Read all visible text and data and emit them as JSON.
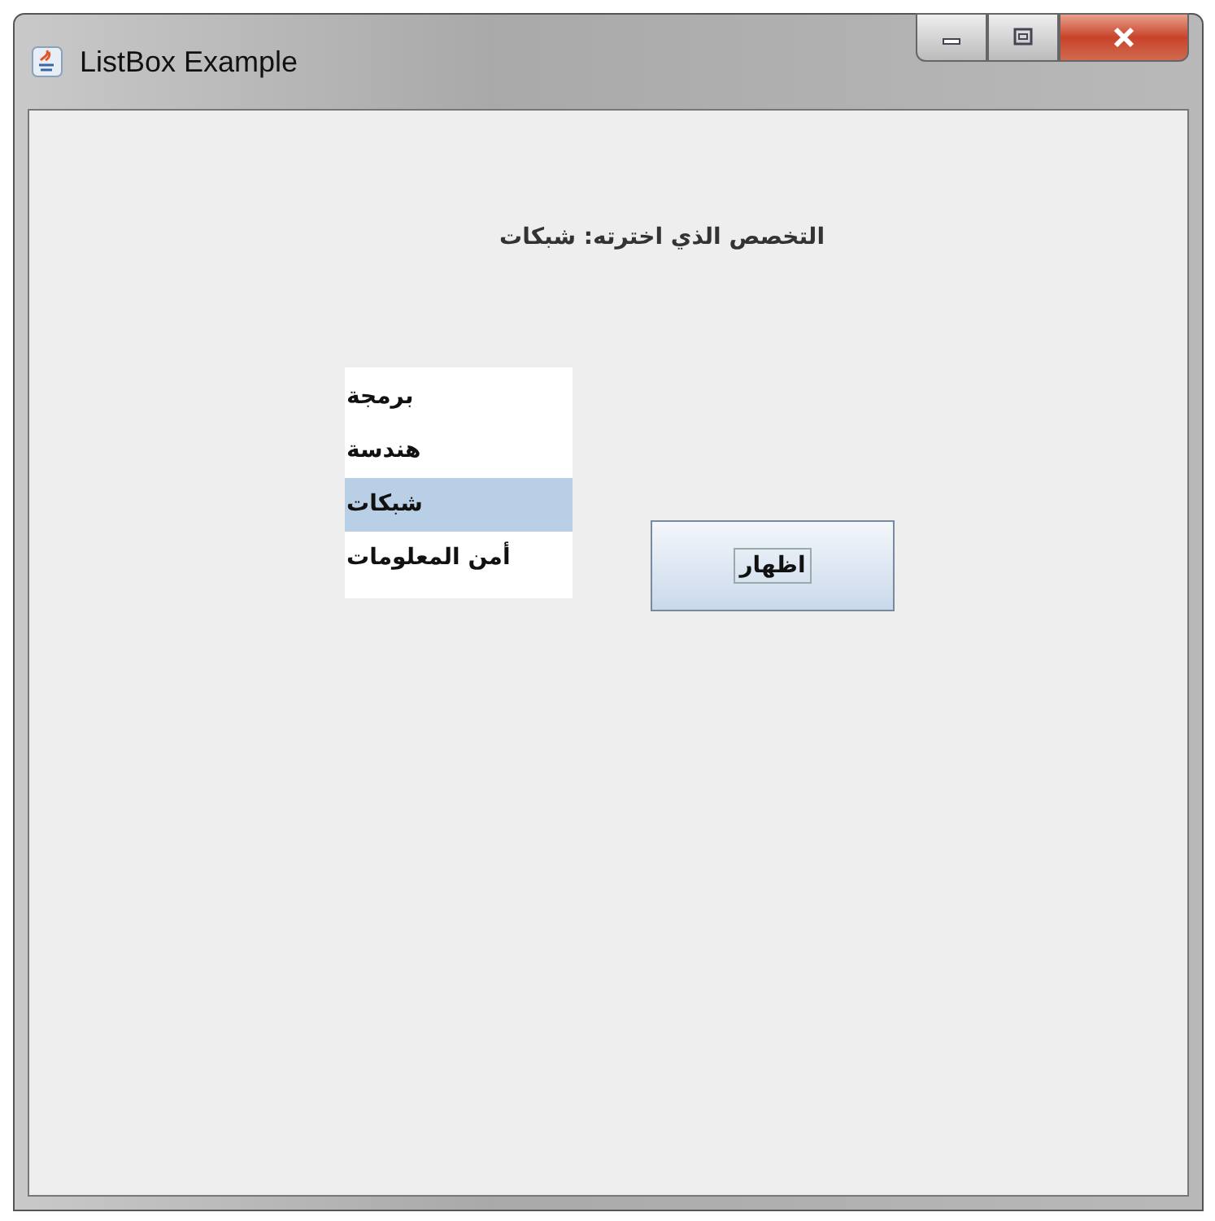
{
  "window": {
    "title": "ListBox Example"
  },
  "label": "التخصص الذي اخترته: شبكات",
  "list": [
    {
      "text": "برمجة",
      "selected": false
    },
    {
      "text": "هندسة",
      "selected": false
    },
    {
      "text": "شبكات",
      "selected": true
    },
    {
      "text": "أمن المعلومات",
      "selected": false
    }
  ],
  "button": "اظهار"
}
